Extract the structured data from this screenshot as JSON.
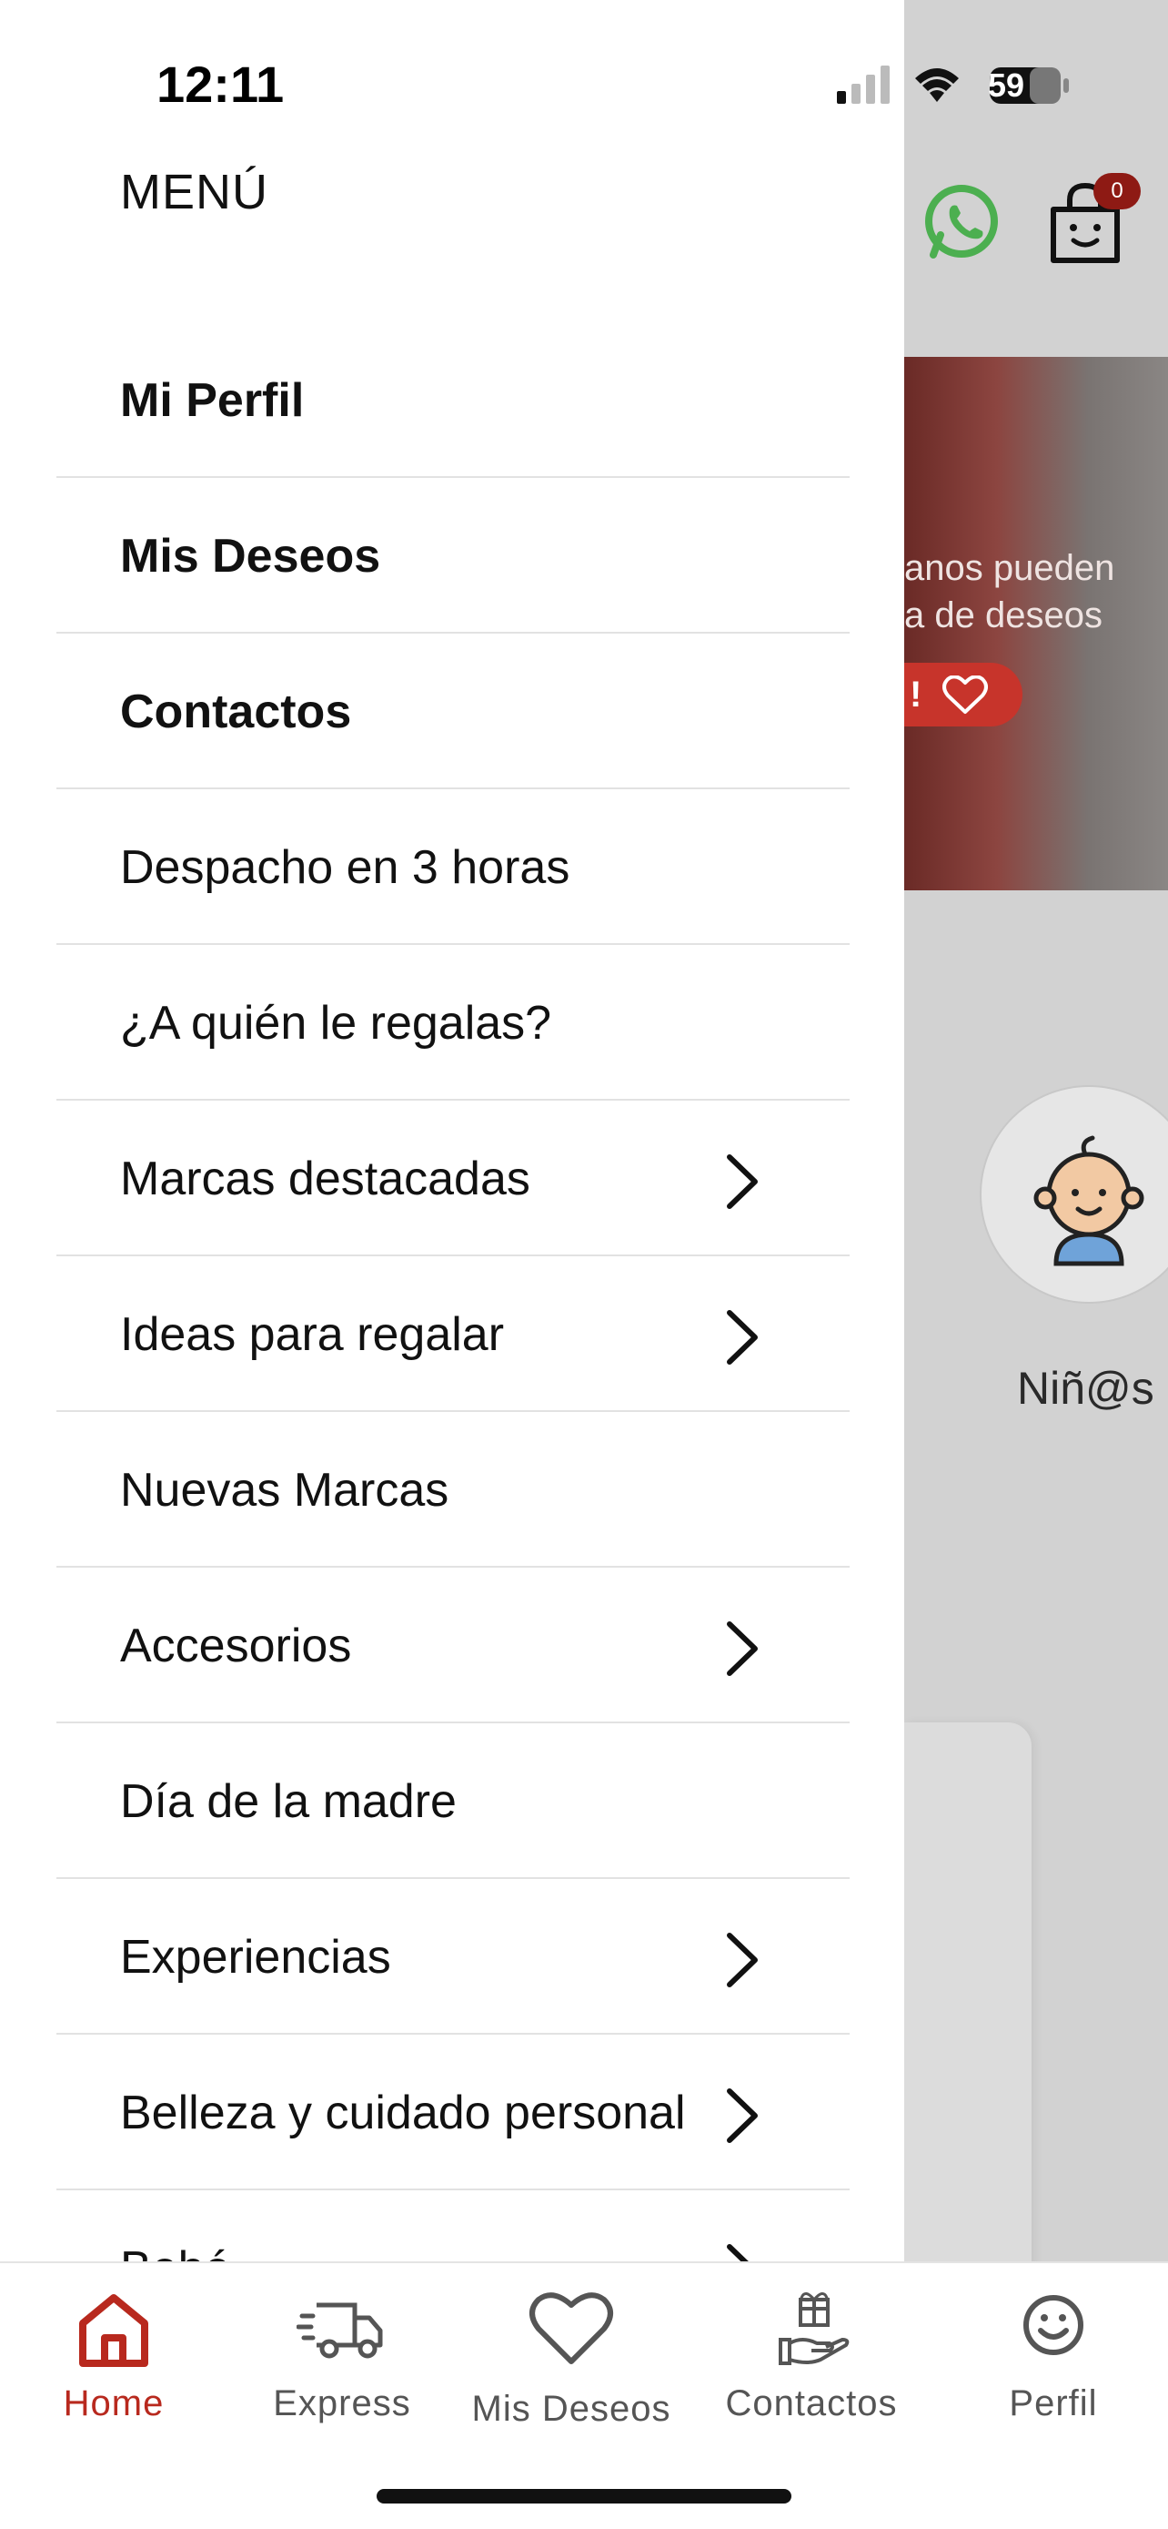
{
  "status_bar": {
    "time": "12:11",
    "battery": "59"
  },
  "menu": {
    "title": "MENÚ",
    "items": [
      {
        "label": "Mi Perfil",
        "bold": true,
        "has_submenu": false
      },
      {
        "label": "Mis Deseos",
        "bold": true,
        "has_submenu": false
      },
      {
        "label": "Contactos",
        "bold": true,
        "has_submenu": false
      },
      {
        "label": "Despacho en 3 horas",
        "bold": false,
        "has_submenu": false
      },
      {
        "label": "¿A quién le regalas?",
        "bold": false,
        "has_submenu": false
      },
      {
        "label": "Marcas destacadas",
        "bold": false,
        "has_submenu": true
      },
      {
        "label": "Ideas para regalar",
        "bold": false,
        "has_submenu": true
      },
      {
        "label": "Nuevas Marcas",
        "bold": false,
        "has_submenu": false
      },
      {
        "label": "Accesorios",
        "bold": false,
        "has_submenu": true
      },
      {
        "label": "Día de la madre",
        "bold": false,
        "has_submenu": false
      },
      {
        "label": "Experiencias",
        "bold": false,
        "has_submenu": true
      },
      {
        "label": "Belleza y cuidado personal",
        "bold": false,
        "has_submenu": true
      },
      {
        "label": "Bebé",
        "bold": false,
        "has_submenu": true
      }
    ]
  },
  "background": {
    "cart_count": "0",
    "banner_text_line1": "anos pueden",
    "banner_text_line2": "a de deseos",
    "banner_button": "!",
    "category_label": "Niñ@s"
  },
  "tabbar": {
    "tabs": [
      {
        "label": "Home",
        "icon": "home-icon",
        "active": true
      },
      {
        "label": "Express",
        "icon": "truck-icon",
        "active": false
      },
      {
        "label": "Mis Deseos",
        "icon": "heart-icon",
        "active": false
      },
      {
        "label": "Contactos",
        "icon": "gift-hand-icon",
        "active": false
      },
      {
        "label": "Perfil",
        "icon": "smiley-icon",
        "active": false
      }
    ]
  },
  "colors": {
    "accent": "#b8291e",
    "whatsapp": "#4caf50",
    "badge": "#8e1a14",
    "overlay": "#d2d2d2"
  }
}
